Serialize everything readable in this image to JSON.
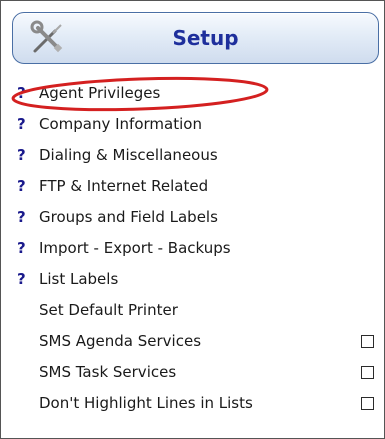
{
  "header": {
    "title": "Setup",
    "icon": "tools-icon"
  },
  "items": [
    {
      "label": "Agent Privileges",
      "help": true,
      "checkbox": false
    },
    {
      "label": "Company Information",
      "help": true,
      "checkbox": false
    },
    {
      "label": "Dialing & Miscellaneous",
      "help": true,
      "checkbox": false
    },
    {
      "label": "FTP & Internet Related",
      "help": true,
      "checkbox": false
    },
    {
      "label": "Groups and Field Labels",
      "help": true,
      "checkbox": false
    },
    {
      "label": "Import - Export - Backups",
      "help": true,
      "checkbox": false
    },
    {
      "label": "List Labels",
      "help": true,
      "checkbox": false
    },
    {
      "label": "Set Default Printer",
      "help": false,
      "checkbox": false
    },
    {
      "label": "SMS Agenda Services",
      "help": false,
      "checkbox": true,
      "checked": false
    },
    {
      "label": "SMS Task Services",
      "help": false,
      "checkbox": true,
      "checked": false
    },
    {
      "label": "Don't Highlight Lines in Lists",
      "help": false,
      "checkbox": true,
      "checked": false
    }
  ],
  "help_glyph": "?",
  "colors": {
    "header_title": "#1e2f9c",
    "help_glyph": "#1a1a8c",
    "highlight_oval": "#d42020",
    "header_border": "#4a6fa5"
  }
}
